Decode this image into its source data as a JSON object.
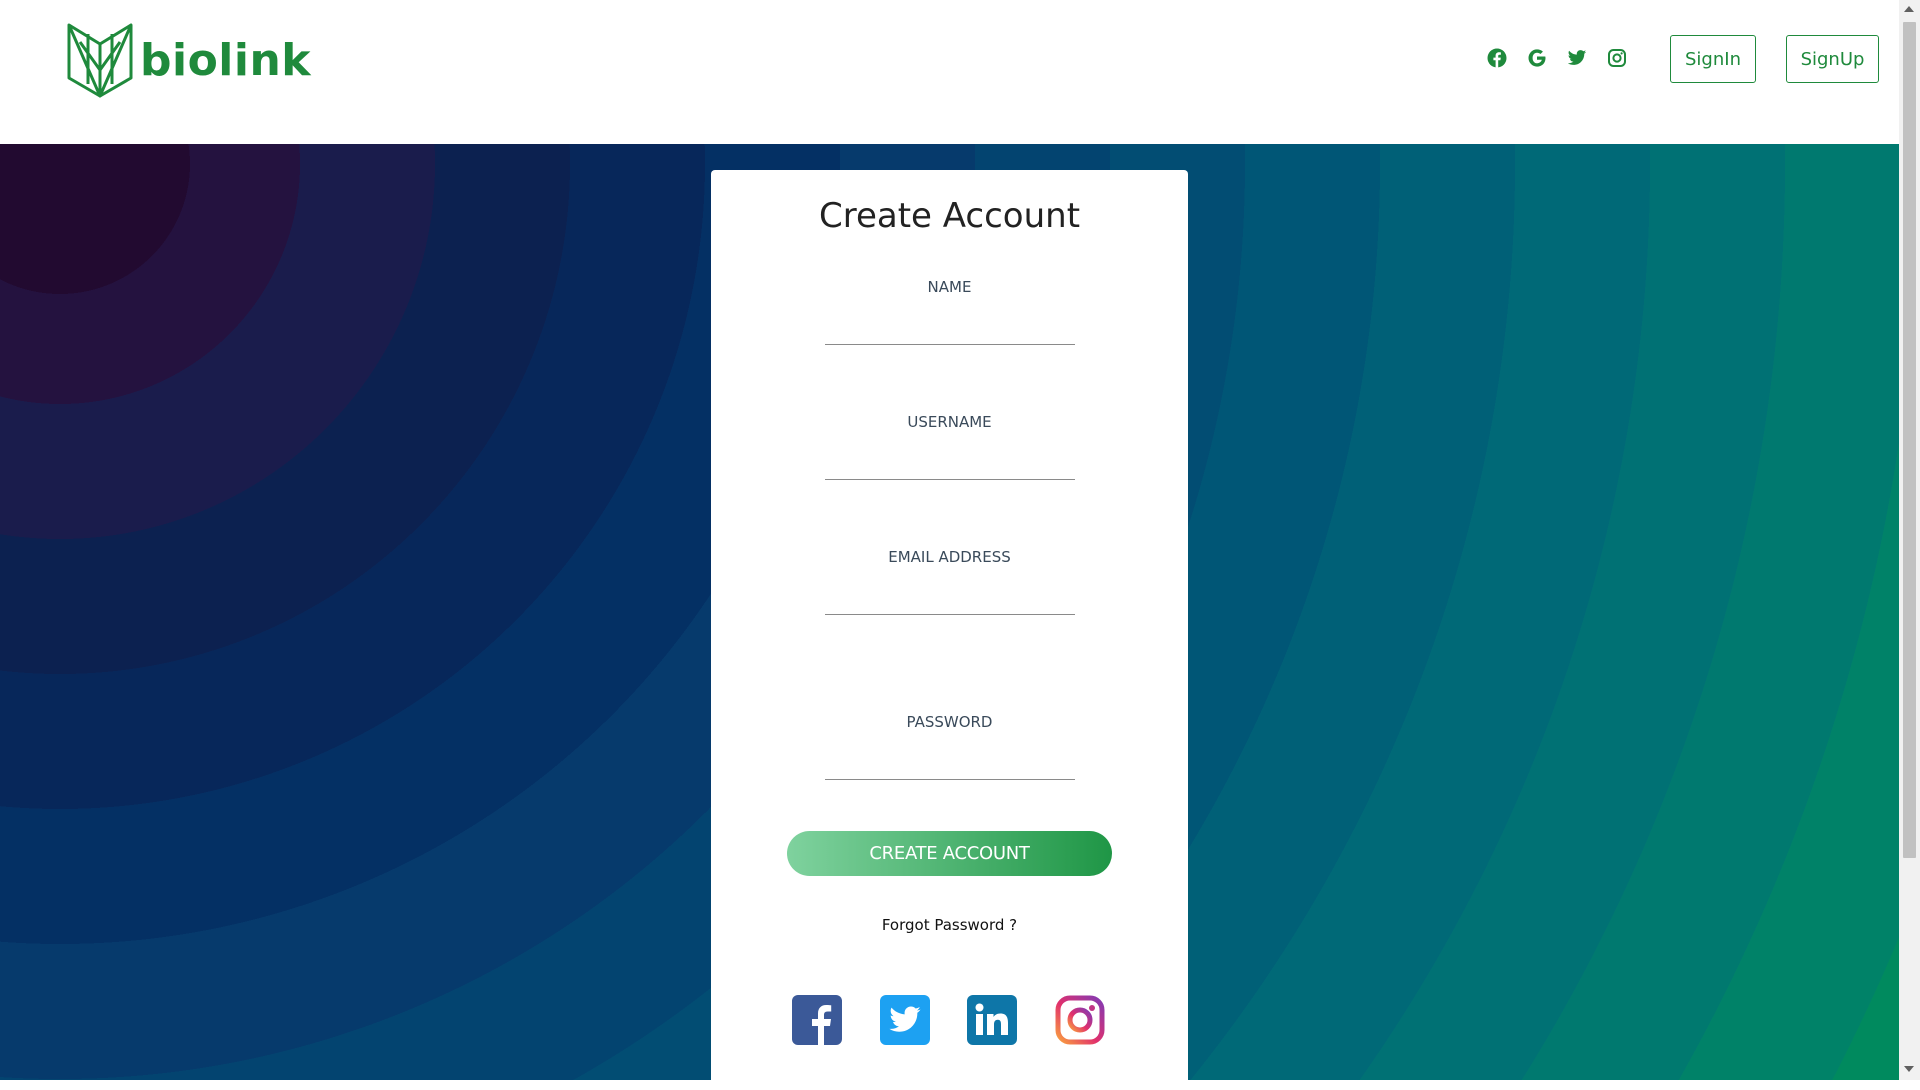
{
  "header": {
    "logo_text": "biolink",
    "social_icons": [
      "facebook-icon",
      "google-icon",
      "twitter-icon",
      "instagram-icon"
    ],
    "signin_label": "SignIn",
    "signup_label": "SignUp"
  },
  "form": {
    "title": "Create Account",
    "fields": [
      {
        "label": "NAME",
        "value": ""
      },
      {
        "label": "USERNAME",
        "value": ""
      },
      {
        "label": "EMAIL ADDRESS",
        "value": ""
      },
      {
        "label": "PASSWORD",
        "value": ""
      }
    ],
    "submit_label": "CREATE ACCOUNT",
    "forgot_label": "Forgot Password ?",
    "social_buttons": [
      "facebook-icon",
      "twitter-icon",
      "linkedin-icon",
      "instagram-icon"
    ]
  },
  "colors": {
    "brand": "#1f8a3c",
    "facebook": "#3b5998",
    "twitter": "#1da1f2",
    "linkedin": "#0e76a8"
  }
}
